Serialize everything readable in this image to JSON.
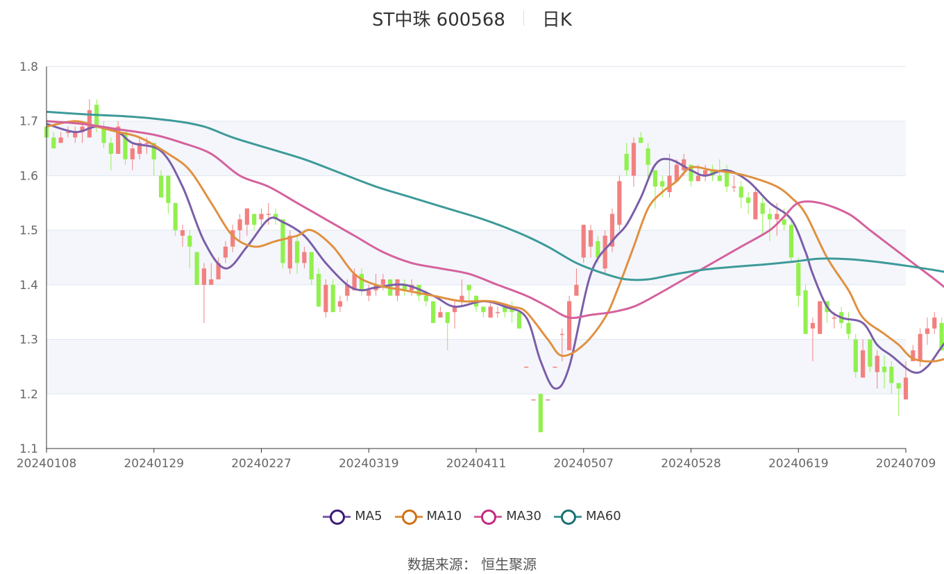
{
  "header": {
    "title": "ST中珠 600568",
    "period": "日K"
  },
  "footer": {
    "source": "数据来源： 恒生聚源"
  },
  "colors": {
    "up": "#f28080",
    "down": "#91f04e",
    "band": "#f4f6fb",
    "grid": "#dfe6f2",
    "axis": "#333333"
  },
  "chart_data": {
    "type": "candlestick",
    "ylim": [
      1.1,
      1.8
    ],
    "y_ticks": [
      "1.1",
      "1.2",
      "1.3",
      "1.4",
      "1.5",
      "1.6",
      "1.7",
      "1.8"
    ],
    "x_ticks": [
      "20240108",
      "20240129",
      "20240227",
      "20240319",
      "20240411",
      "20240507",
      "20240528",
      "20240619",
      "20240709"
    ],
    "n_days": 121,
    "candles": [
      [
        1.69,
        1.67,
        1.7,
        1.66
      ],
      [
        1.67,
        1.65,
        1.68,
        1.65
      ],
      [
        1.66,
        1.67,
        1.68,
        1.66
      ],
      [
        1.68,
        1.68,
        1.69,
        1.67
      ],
      [
        1.67,
        1.68,
        1.69,
        1.66
      ],
      [
        1.68,
        1.69,
        1.7,
        1.66
      ],
      [
        1.67,
        1.72,
        1.74,
        1.67
      ],
      [
        1.73,
        1.69,
        1.74,
        1.68
      ],
      [
        1.69,
        1.66,
        1.7,
        1.65
      ],
      [
        1.66,
        1.64,
        1.67,
        1.61
      ],
      [
        1.64,
        1.69,
        1.7,
        1.64
      ],
      [
        1.68,
        1.63,
        1.68,
        1.62
      ],
      [
        1.63,
        1.65,
        1.66,
        1.61
      ],
      [
        1.64,
        1.66,
        1.67,
        1.63
      ],
      [
        1.66,
        1.66,
        1.67,
        1.64
      ],
      [
        1.66,
        1.63,
        1.66,
        1.6
      ],
      [
        1.6,
        1.56,
        1.61,
        1.56
      ],
      [
        1.6,
        1.55,
        1.6,
        1.53
      ],
      [
        1.55,
        1.5,
        1.55,
        1.49
      ],
      [
        1.49,
        1.5,
        1.51,
        1.47
      ],
      [
        1.49,
        1.47,
        1.5,
        1.43
      ],
      [
        1.46,
        1.4,
        1.46,
        1.4
      ],
      [
        1.4,
        1.43,
        1.44,
        1.33
      ],
      [
        1.4,
        1.41,
        1.44,
        1.4
      ],
      [
        1.41,
        1.44,
        1.45,
        1.41
      ],
      [
        1.45,
        1.47,
        1.48,
        1.44
      ],
      [
        1.47,
        1.5,
        1.51,
        1.46
      ],
      [
        1.5,
        1.52,
        1.53,
        1.48
      ],
      [
        1.51,
        1.54,
        1.54,
        1.49
      ],
      [
        1.53,
        1.51,
        1.53,
        1.5
      ],
      [
        1.52,
        1.53,
        1.54,
        1.51
      ],
      [
        1.53,
        1.53,
        1.55,
        1.51
      ],
      [
        1.53,
        1.52,
        1.54,
        1.51
      ],
      [
        1.52,
        1.44,
        1.52,
        1.43
      ],
      [
        1.43,
        1.49,
        1.5,
        1.42
      ],
      [
        1.48,
        1.44,
        1.49,
        1.42
      ],
      [
        1.44,
        1.46,
        1.47,
        1.43
      ],
      [
        1.46,
        1.41,
        1.46,
        1.4
      ],
      [
        1.42,
        1.36,
        1.43,
        1.36
      ],
      [
        1.35,
        1.4,
        1.41,
        1.34
      ],
      [
        1.4,
        1.35,
        1.41,
        1.35
      ],
      [
        1.36,
        1.37,
        1.38,
        1.35
      ],
      [
        1.38,
        1.4,
        1.41,
        1.37
      ],
      [
        1.39,
        1.42,
        1.43,
        1.39
      ],
      [
        1.42,
        1.39,
        1.43,
        1.38
      ],
      [
        1.38,
        1.39,
        1.4,
        1.37
      ],
      [
        1.39,
        1.4,
        1.42,
        1.38
      ],
      [
        1.4,
        1.41,
        1.42,
        1.39
      ],
      [
        1.41,
        1.38,
        1.41,
        1.38
      ],
      [
        1.38,
        1.41,
        1.41,
        1.37
      ],
      [
        1.4,
        1.39,
        1.41,
        1.38
      ],
      [
        1.39,
        1.4,
        1.41,
        1.38
      ],
      [
        1.4,
        1.38,
        1.4,
        1.37
      ],
      [
        1.38,
        1.37,
        1.39,
        1.36
      ],
      [
        1.37,
        1.33,
        1.37,
        1.33
      ],
      [
        1.34,
        1.35,
        1.36,
        1.34
      ],
      [
        1.35,
        1.33,
        1.35,
        1.28
      ],
      [
        1.35,
        1.36,
        1.37,
        1.32
      ],
      [
        1.37,
        1.38,
        1.41,
        1.36
      ],
      [
        1.4,
        1.39,
        1.4,
        1.37
      ],
      [
        1.38,
        1.36,
        1.38,
        1.35
      ],
      [
        1.36,
        1.35,
        1.36,
        1.34
      ],
      [
        1.34,
        1.36,
        1.37,
        1.34
      ],
      [
        1.35,
        1.35,
        1.36,
        1.34
      ],
      [
        1.36,
        1.35,
        1.36,
        1.34
      ],
      [
        1.36,
        1.35,
        1.37,
        1.33
      ],
      [
        1.35,
        1.32,
        1.35,
        1.32
      ],
      [
        1.25,
        1.25,
        1.25,
        1.25
      ],
      [
        1.19,
        1.19,
        1.19,
        1.19
      ],
      [
        1.2,
        1.13,
        1.2,
        1.13
      ],
      [
        1.19,
        1.19,
        1.19,
        1.19
      ],
      [
        1.25,
        1.25,
        1.25,
        1.25
      ],
      [
        1.31,
        1.31,
        1.32,
        1.26
      ],
      [
        1.28,
        1.37,
        1.38,
        1.28
      ],
      [
        1.38,
        1.4,
        1.43,
        1.38
      ],
      [
        1.45,
        1.51,
        1.51,
        1.44
      ],
      [
        1.47,
        1.5,
        1.51,
        1.45
      ],
      [
        1.48,
        1.45,
        1.49,
        1.44
      ],
      [
        1.43,
        1.49,
        1.5,
        1.42
      ],
      [
        1.47,
        1.53,
        1.54,
        1.46
      ],
      [
        1.51,
        1.59,
        1.6,
        1.5
      ],
      [
        1.64,
        1.61,
        1.66,
        1.6
      ],
      [
        1.6,
        1.66,
        1.67,
        1.58
      ],
      [
        1.67,
        1.66,
        1.68,
        1.66
      ],
      [
        1.65,
        1.62,
        1.66,
        1.59
      ],
      [
        1.61,
        1.58,
        1.61,
        1.54
      ],
      [
        1.59,
        1.58,
        1.6,
        1.56
      ],
      [
        1.57,
        1.6,
        1.64,
        1.56
      ],
      [
        1.59,
        1.62,
        1.63,
        1.59
      ],
      [
        1.61,
        1.63,
        1.64,
        1.6
      ],
      [
        1.62,
        1.59,
        1.62,
        1.58
      ],
      [
        1.59,
        1.6,
        1.62,
        1.59
      ],
      [
        1.6,
        1.61,
        1.62,
        1.59
      ],
      [
        1.61,
        1.6,
        1.62,
        1.59
      ],
      [
        1.6,
        1.59,
        1.63,
        1.59
      ],
      [
        1.61,
        1.58,
        1.62,
        1.57
      ],
      [
        1.58,
        1.58,
        1.6,
        1.57
      ],
      [
        1.58,
        1.56,
        1.59,
        1.54
      ],
      [
        1.56,
        1.55,
        1.57,
        1.53
      ],
      [
        1.52,
        1.57,
        1.58,
        1.52
      ],
      [
        1.55,
        1.53,
        1.56,
        1.49
      ],
      [
        1.53,
        1.52,
        1.54,
        1.48
      ],
      [
        1.52,
        1.53,
        1.55,
        1.49
      ],
      [
        1.52,
        1.51,
        1.54,
        1.5
      ],
      [
        1.51,
        1.45,
        1.52,
        1.44
      ],
      [
        1.44,
        1.38,
        1.45,
        1.36
      ],
      [
        1.39,
        1.31,
        1.4,
        1.31
      ],
      [
        1.32,
        1.33,
        1.34,
        1.26
      ],
      [
        1.31,
        1.37,
        1.37,
        1.31
      ],
      [
        1.37,
        1.35,
        1.37,
        1.33
      ],
      [
        1.34,
        1.34,
        1.35,
        1.32
      ],
      [
        1.35,
        1.33,
        1.36,
        1.32
      ],
      [
        1.33,
        1.31,
        1.35,
        1.3
      ],
      [
        1.3,
        1.24,
        1.31,
        1.23
      ],
      [
        1.23,
        1.28,
        1.3,
        1.23
      ],
      [
        1.3,
        1.25,
        1.3,
        1.24
      ],
      [
        1.24,
        1.27,
        1.28,
        1.21
      ],
      [
        1.25,
        1.24,
        1.27,
        1.21
      ],
      [
        1.25,
        1.22,
        1.26,
        1.2
      ],
      [
        1.22,
        1.21,
        1.22,
        1.16
      ],
      [
        1.19,
        1.23,
        1.26,
        1.19
      ],
      [
        1.26,
        1.28,
        1.29,
        1.26
      ],
      [
        1.26,
        1.31,
        1.32,
        1.25
      ],
      [
        1.31,
        1.32,
        1.34,
        1.29
      ],
      [
        1.32,
        1.34,
        1.35,
        1.31
      ],
      [
        1.33,
        1.28,
        1.34,
        1.28
      ]
    ],
    "series": [
      {
        "name": "MA5",
        "color": "#7b5ea8",
        "points": [
          [
            0,
            1.695
          ],
          [
            4,
            1.68
          ],
          [
            7,
            1.69
          ],
          [
            10,
            1.68
          ],
          [
            12,
            1.66
          ],
          [
            16,
            1.645
          ],
          [
            19,
            1.58
          ],
          [
            22,
            1.48
          ],
          [
            25,
            1.43
          ],
          [
            28,
            1.47
          ],
          [
            31,
            1.52
          ],
          [
            33,
            1.515
          ],
          [
            36,
            1.49
          ],
          [
            39,
            1.44
          ],
          [
            42,
            1.4
          ],
          [
            44,
            1.39
          ],
          [
            46,
            1.395
          ],
          [
            50,
            1.4
          ],
          [
            54,
            1.38
          ],
          [
            57,
            1.36
          ],
          [
            61,
            1.37
          ],
          [
            64,
            1.36
          ],
          [
            67,
            1.34
          ],
          [
            69,
            1.26
          ],
          [
            71,
            1.21
          ],
          [
            73,
            1.25
          ],
          [
            76,
            1.42
          ],
          [
            79,
            1.48
          ],
          [
            81,
            1.51
          ],
          [
            83,
            1.56
          ],
          [
            85,
            1.62
          ],
          [
            87,
            1.63
          ],
          [
            90,
            1.61
          ],
          [
            92,
            1.6
          ],
          [
            95,
            1.61
          ],
          [
            98,
            1.59
          ],
          [
            101,
            1.55
          ],
          [
            104,
            1.52
          ],
          [
            106,
            1.46
          ],
          [
            107,
            1.42
          ],
          [
            109,
            1.36
          ],
          [
            111,
            1.34
          ],
          [
            114,
            1.33
          ],
          [
            116,
            1.29
          ],
          [
            118,
            1.27
          ],
          [
            121,
            1.24
          ],
          [
            123,
            1.25
          ],
          [
            126,
            1.3
          ],
          [
            129,
            1.3
          ]
        ]
      },
      {
        "name": "MA10",
        "color": "#e09040",
        "points": [
          [
            0,
            1.69
          ],
          [
            4,
            1.7
          ],
          [
            7,
            1.69
          ],
          [
            10,
            1.68
          ],
          [
            13,
            1.67
          ],
          [
            17,
            1.64
          ],
          [
            20,
            1.61
          ],
          [
            23,
            1.55
          ],
          [
            26,
            1.49
          ],
          [
            29,
            1.47
          ],
          [
            32,
            1.48
          ],
          [
            35,
            1.49
          ],
          [
            37,
            1.5
          ],
          [
            40,
            1.47
          ],
          [
            43,
            1.42
          ],
          [
            46,
            1.4
          ],
          [
            50,
            1.39
          ],
          [
            54,
            1.38
          ],
          [
            58,
            1.37
          ],
          [
            62,
            1.37
          ],
          [
            65,
            1.36
          ],
          [
            67,
            1.35
          ],
          [
            70,
            1.3
          ],
          [
            72,
            1.27
          ],
          [
            75,
            1.29
          ],
          [
            78,
            1.34
          ],
          [
            80,
            1.4
          ],
          [
            82,
            1.47
          ],
          [
            84,
            1.54
          ],
          [
            86,
            1.57
          ],
          [
            88,
            1.59
          ],
          [
            90,
            1.615
          ],
          [
            93,
            1.61
          ],
          [
            96,
            1.605
          ],
          [
            99,
            1.595
          ],
          [
            102,
            1.58
          ],
          [
            104,
            1.56
          ],
          [
            106,
            1.53
          ],
          [
            109,
            1.45
          ],
          [
            112,
            1.39
          ],
          [
            114,
            1.34
          ],
          [
            117,
            1.31
          ],
          [
            119,
            1.29
          ],
          [
            121,
            1.265
          ],
          [
            124,
            1.26
          ],
          [
            127,
            1.27
          ],
          [
            129,
            1.27
          ]
        ]
      },
      {
        "name": "MA30",
        "color": "#d5619c",
        "points": [
          [
            0,
            1.7
          ],
          [
            5,
            1.695
          ],
          [
            10,
            1.685
          ],
          [
            15,
            1.675
          ],
          [
            19,
            1.66
          ],
          [
            23,
            1.64
          ],
          [
            27,
            1.6
          ],
          [
            31,
            1.58
          ],
          [
            35,
            1.55
          ],
          [
            39,
            1.52
          ],
          [
            43,
            1.49
          ],
          [
            47,
            1.46
          ],
          [
            51,
            1.44
          ],
          [
            55,
            1.43
          ],
          [
            59,
            1.42
          ],
          [
            63,
            1.4
          ],
          [
            67,
            1.38
          ],
          [
            70,
            1.36
          ],
          [
            73,
            1.34
          ],
          [
            76,
            1.345
          ],
          [
            79,
            1.35
          ],
          [
            82,
            1.36
          ],
          [
            85,
            1.38
          ],
          [
            89,
            1.41
          ],
          [
            93,
            1.44
          ],
          [
            97,
            1.47
          ],
          [
            101,
            1.5
          ],
          [
            103,
            1.525
          ],
          [
            105,
            1.55
          ],
          [
            108,
            1.55
          ],
          [
            112,
            1.53
          ],
          [
            115,
            1.5
          ],
          [
            118,
            1.47
          ],
          [
            121,
            1.44
          ],
          [
            125,
            1.4
          ],
          [
            129,
            1.355
          ]
        ]
      },
      {
        "name": "MA60",
        "color": "#3d9a99",
        "points": [
          [
            0,
            1.717
          ],
          [
            6,
            1.712
          ],
          [
            12,
            1.708
          ],
          [
            18,
            1.7
          ],
          [
            22,
            1.69
          ],
          [
            26,
            1.67
          ],
          [
            31,
            1.65
          ],
          [
            36,
            1.63
          ],
          [
            41,
            1.605
          ],
          [
            46,
            1.58
          ],
          [
            51,
            1.56
          ],
          [
            56,
            1.54
          ],
          [
            61,
            1.52
          ],
          [
            66,
            1.495
          ],
          [
            70,
            1.47
          ],
          [
            74,
            1.44
          ],
          [
            78,
            1.42
          ],
          [
            81,
            1.41
          ],
          [
            84,
            1.41
          ],
          [
            88,
            1.42
          ],
          [
            92,
            1.428
          ],
          [
            96,
            1.433
          ],
          [
            100,
            1.437
          ],
          [
            104,
            1.442
          ],
          [
            108,
            1.448
          ],
          [
            112,
            1.447
          ],
          [
            116,
            1.442
          ],
          [
            120,
            1.435
          ],
          [
            124,
            1.427
          ],
          [
            127,
            1.42
          ],
          [
            129,
            1.418
          ]
        ]
      }
    ]
  }
}
